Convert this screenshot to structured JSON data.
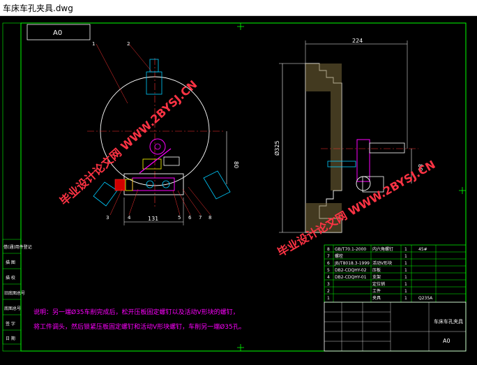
{
  "window": {
    "title": "车床车孔夹具.dwg"
  },
  "drawing": {
    "sheet_size": "A0",
    "dims": {
      "width_131": "131",
      "width_224": "224",
      "height_80a": "80",
      "height_80b": "80",
      "dia_325": "Ø325"
    },
    "balloons": [
      "1",
      "2",
      "3",
      "4",
      "5",
      "6",
      "7",
      "8"
    ],
    "watermark": "毕业设计论文网 WWW.2BYSJ.CN",
    "notes": {
      "line1": "说明：另一端Ø35车削完成后，松开压板固定螺钉以及活动V形块的螺钉，",
      "line2": "将工件调头，然后锁紧压板固定螺钉和活动V形块螺钉，车削另一端Ø35孔。"
    },
    "left_labels": [
      "借(通)用件登记",
      "描 图",
      "描 校",
      "旧底图总号",
      "底图总号",
      "签 字",
      "日 期"
    ],
    "bom_rows": [
      {
        "no": "8",
        "code": "GB/T70.1-2000",
        "name": "内六角螺钉",
        "qty": "1",
        "mat": "45#"
      },
      {
        "no": "7",
        "code": "螺栓",
        "name": "",
        "qty": "1",
        "mat": ""
      },
      {
        "no": "6",
        "code": "JB/T8018.3-1999",
        "name": "活动V形块",
        "qty": "1",
        "mat": ""
      },
      {
        "no": "5",
        "code": "DB2-CDQHY-02",
        "name": "压板",
        "qty": "1",
        "mat": ""
      },
      {
        "no": "4",
        "code": "DB2-CDQHY-01",
        "name": "支架",
        "qty": "1",
        "mat": ""
      },
      {
        "no": "3",
        "code": "",
        "name": "定位销",
        "qty": "1",
        "mat": ""
      },
      {
        "no": "2",
        "code": "",
        "name": "工件",
        "qty": "1",
        "mat": ""
      },
      {
        "no": "1",
        "code": "",
        "name": "夹具",
        "qty": "1",
        "mat": "Q235A"
      }
    ],
    "title_block": {
      "title": "车床车孔夹具",
      "sheet": "A0"
    }
  }
}
